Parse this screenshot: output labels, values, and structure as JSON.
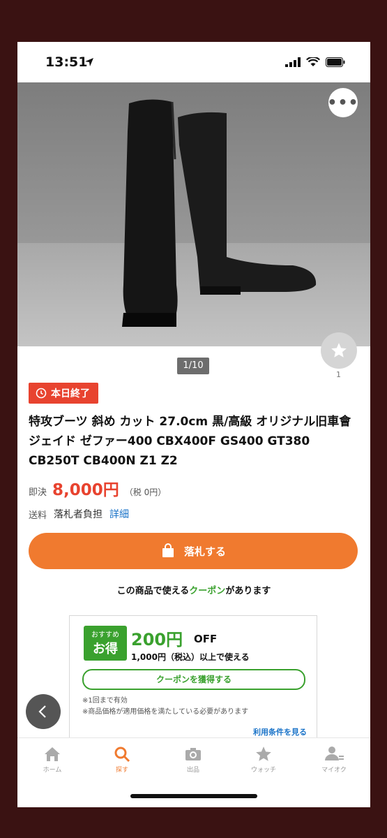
{
  "status_bar": {
    "time": "13:51"
  },
  "hero": {
    "counter": "1/10",
    "watch_count": "1"
  },
  "item": {
    "badge": "本日終了",
    "title": "特攻ブーツ 斜め カット 27.0cm 黒/高級 オリジナル旧車會 ジェイド ゼファー400 CBX400F GS400 GT380 CB250T CB400N Z1 Z2",
    "price_label": "即決",
    "price": "8,000円",
    "tax": "（税 0円）",
    "shipping_label": "送料",
    "shipping_value": "落札者負担",
    "shipping_detail": "詳細",
    "bid_button": "落札する"
  },
  "coupon": {
    "note_prefix": "この商品で使える",
    "note_highlight": "クーポン",
    "note_suffix": "があります",
    "reco_small": "おすすめ",
    "reco_big": "お得",
    "amount": "200円",
    "off": "OFF",
    "condition": "1,000円（税込）以上で使える",
    "get_button": "クーポンを獲得する",
    "note1": "※1回まで有効",
    "note2": "※商品価格が適用価格を満たしている必要があります",
    "terms": "利用条件を見る"
  },
  "tabbar": {
    "items": [
      {
        "label": "ホーム",
        "icon": "home-icon"
      },
      {
        "label": "探す",
        "icon": "search-icon"
      },
      {
        "label": "出品",
        "icon": "camera-icon"
      },
      {
        "label": "ウォッチ",
        "icon": "star-icon"
      },
      {
        "label": "マイオク",
        "icon": "user-icon"
      }
    ]
  },
  "colors": {
    "accent": "#f07a2f",
    "badge": "#e8432f",
    "coupon": "#3aa12e",
    "link": "#1a73c8"
  }
}
